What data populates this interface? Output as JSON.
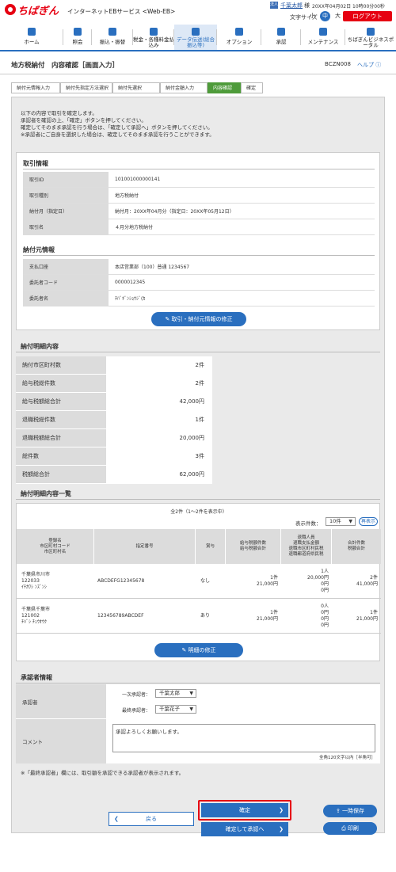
{
  "header": {
    "logo": "ちばぎん",
    "service": "インターネットEBサービス <Web-EB>",
    "user_icon": "法人",
    "user_name": "千葉太郎",
    "user_suffix": "様",
    "login_datetime": "20XX年04月02日 10時00分00秒",
    "font_size_label": "文字サイズ",
    "font_small": "小",
    "font_medium": "中",
    "font_large": "大",
    "logout": "ログアウト"
  },
  "nav": [
    {
      "label": "ホーム",
      "icon": "home-icon"
    },
    {
      "label": "照会",
      "icon": "inquiry-icon"
    },
    {
      "label": "振込・振替",
      "icon": "transfer-icon"
    },
    {
      "label": "税金・各種料金払込み",
      "icon": "tax-icon"
    },
    {
      "label": "データ伝送(総合振込等)",
      "icon": "data-transfer-icon"
    },
    {
      "label": "オプション",
      "icon": "option-icon"
    },
    {
      "label": "承認",
      "icon": "approve-icon"
    },
    {
      "label": "メンテナンス",
      "icon": "maintenance-icon"
    },
    {
      "label": "ちばぎんビジネスポータル",
      "icon": "portal-icon"
    }
  ],
  "page": {
    "title": "地方税納付　内容確認［画面入力］",
    "code": "BCZN008",
    "help": "ヘルプ"
  },
  "steps": [
    "納付元情報入力",
    "納付先指定方法選択",
    "納付先選択",
    "納付金額入力",
    "内容確認",
    "確定"
  ],
  "message": [
    "以下の内容で取引を確定します。",
    "承認者を確認の上、「確定」ボタンを押してください。",
    "確定してそのまま承認を行う場合は、「確定して承認へ」ボタンを押してください。",
    "※承認者にご自身を選択した場合は、確定してそのまま承認を行うことができます。"
  ],
  "transaction": {
    "title": "取引情報",
    "rows": [
      {
        "key": "取引ID",
        "value": "101001000000141"
      },
      {
        "key": "取引種別",
        "value": "地方税納付"
      },
      {
        "key": "納付月（指定日）",
        "value": "納付月：20XX年04月分（指定日：20XX年05月12日）"
      },
      {
        "key": "取引名",
        "value": "４月分地方税納付"
      }
    ]
  },
  "payer": {
    "title": "納付元情報",
    "rows": [
      {
        "key": "支払口座",
        "value": "本店営業部（100）普通 1234567"
      },
      {
        "key": "委託者コード",
        "value": "0000012345"
      },
      {
        "key": "委託者名",
        "value": "ﾁﾊﾞｷﾞﾝｼｮｳｼﾞ(ｶ"
      }
    ],
    "edit_button": "取引・納付元情報の修正"
  },
  "details": {
    "title": "納付明細内容",
    "rows": [
      {
        "key": "納付市区町村数",
        "value": "2件"
      },
      {
        "key": "給与税総件数",
        "value": "2件"
      },
      {
        "key": "給与税額総合計",
        "value": "42,000円"
      },
      {
        "key": "退職税総件数",
        "value": "1件"
      },
      {
        "key": "退職税額総合計",
        "value": "20,000円"
      },
      {
        "key": "総件数",
        "value": "3件"
      },
      {
        "key": "税額総合計",
        "value": "62,000円"
      }
    ]
  },
  "list": {
    "title": "納付明細内容一覧",
    "count": "全2件（1～2件を表示中）",
    "display_count_label": "表示件数：",
    "display_count_value": "10件",
    "redisplay": "再表示",
    "headers": [
      "登録名\n市区町村コード\n市区町村名",
      "指定番号",
      "賞与",
      "給与税額件数\n給与税額合計",
      "退職人員\n退職支払金額\n退職市区町村民税\n退職都道府県民税",
      "合計件数\n税額合計"
    ],
    "rows": [
      {
        "name": "千葉県市川市\n122033\nｲﾁｶﾜｼ ﾝｽﾞﾝｼ",
        "number": "ABCDEFG12345678",
        "bonus": "なし",
        "salary": "1件\n21,000円",
        "retire": "1人\n20,000円\n0円\n0円",
        "total": "2件\n41,000円"
      },
      {
        "name": "千葉県千葉市\n121002\nﾁﾊﾞｼ ﾁｭｳｵｳｸ",
        "number": "123456789ABCDEF",
        "bonus": "あり",
        "salary": "1件\n21,000円",
        "retire": "0人\n0円\n0円\n0円",
        "total": "1件\n21,000円"
      }
    ],
    "edit_button": "明細の修正"
  },
  "approver": {
    "title": "承認者情報",
    "approver_key": "承認者",
    "first_label": "一次承認者：",
    "first_value": "千葉太郎",
    "final_label": "最終承認者：",
    "final_value": "千葉花子",
    "comment_key": "コメント",
    "comment_value": "承認よろしくお願いします。",
    "comment_note": "全角120文字以内［半角可］"
  },
  "note": "※「最終承認者」欄には、取引額を承認できる承認者が表示されます。",
  "buttons": {
    "back": "戻る",
    "confirm": "確定",
    "confirm_approve": "確定して承認へ",
    "save": "一時保存",
    "print": "印刷"
  }
}
